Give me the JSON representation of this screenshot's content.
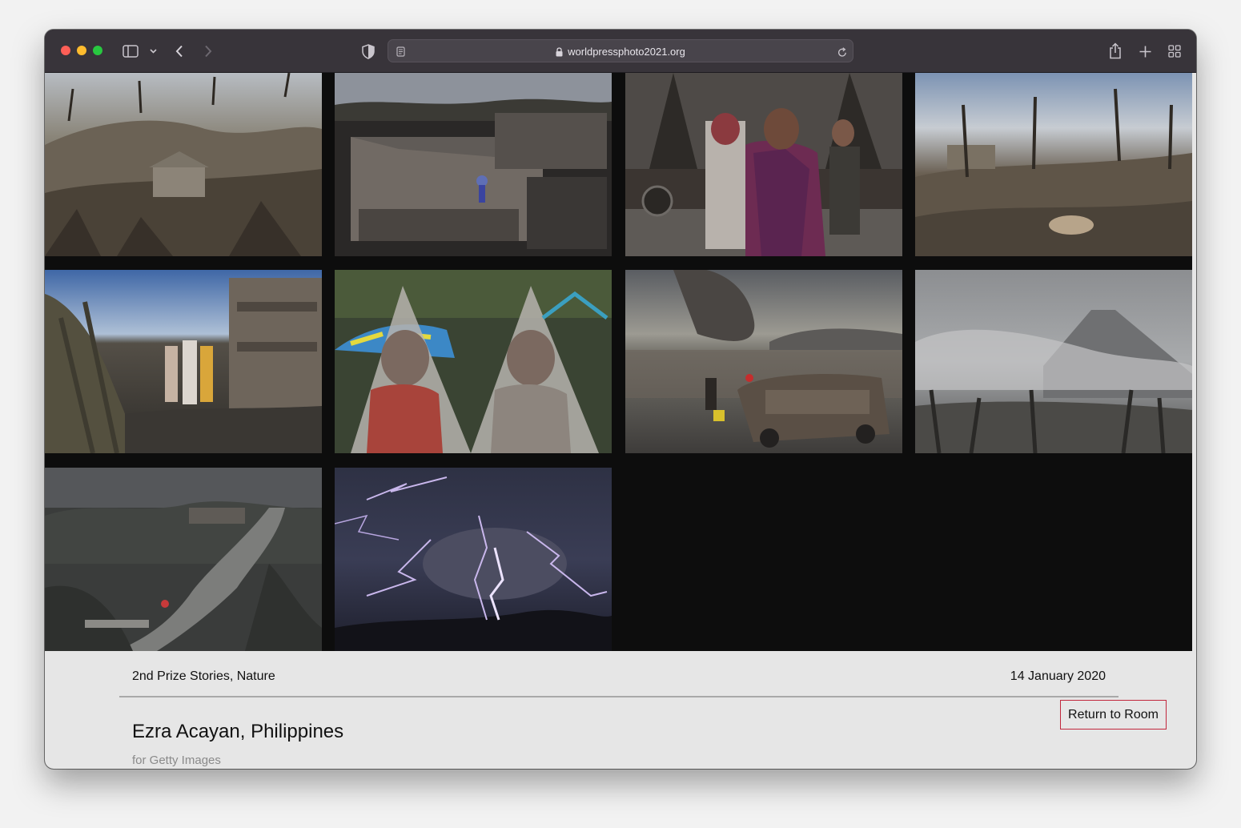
{
  "browser": {
    "url": "worldpressphoto2021.org",
    "icons": [
      "sidebar-icon",
      "chevron-down-icon",
      "back-icon",
      "forward-icon",
      "shield-icon",
      "reader-icon",
      "lock-icon",
      "reload-icon",
      "share-icon",
      "new-tab-icon",
      "tab-overview-icon"
    ]
  },
  "gallery": {
    "photos": [
      {
        "subject": "ash-covered-hillside-house",
        "palette": [
          "#9da1a6",
          "#6b6255",
          "#3d362d"
        ]
      },
      {
        "subject": "ash-covered-rooftops",
        "palette": [
          "#8d929b",
          "#605b57",
          "#2a2827"
        ]
      },
      {
        "subject": "woman-carrying-statue",
        "palette": [
          "#5e5a56",
          "#6d2b52",
          "#3b3531"
        ]
      },
      {
        "subject": "ash-field-with-animal",
        "palette": [
          "#a8b3c2",
          "#5f5548",
          "#2d2823"
        ]
      },
      {
        "subject": "family-in-ash-street",
        "palette": [
          "#6c88b2",
          "#544f47",
          "#2e2c29"
        ]
      },
      {
        "subject": "girls-under-plastic-sheet",
        "palette": [
          "#4b5a3a",
          "#b6b3ae",
          "#a8443b"
        ]
      },
      {
        "subject": "volcano-smoke-over-lake",
        "palette": [
          "#5a5d62",
          "#3e3c3a",
          "#6b625a"
        ]
      },
      {
        "subject": "ash-storm-landscape",
        "palette": [
          "#9ea0a3",
          "#7a7b7c",
          "#3a3937"
        ]
      },
      {
        "subject": "road-through-ash-forest",
        "palette": [
          "#55575a",
          "#3a3c3b",
          "#7c7d7b"
        ]
      },
      {
        "subject": "volcanic-lightning",
        "palette": [
          "#3a3d55",
          "#1d1e2b",
          "#c9b7ec"
        ]
      }
    ]
  },
  "info": {
    "category": "2nd Prize Stories, Nature",
    "date": "14 January 2020",
    "photographer": "Ezra Acayan, Philippines",
    "agency": "for Getty Images",
    "return_label": "Return to Room"
  },
  "colors": {
    "toolbar": "#38343a",
    "gallery_bg": "#0d0d0d",
    "info_bg": "#e6e6e6",
    "button_border": "#c1273d"
  }
}
